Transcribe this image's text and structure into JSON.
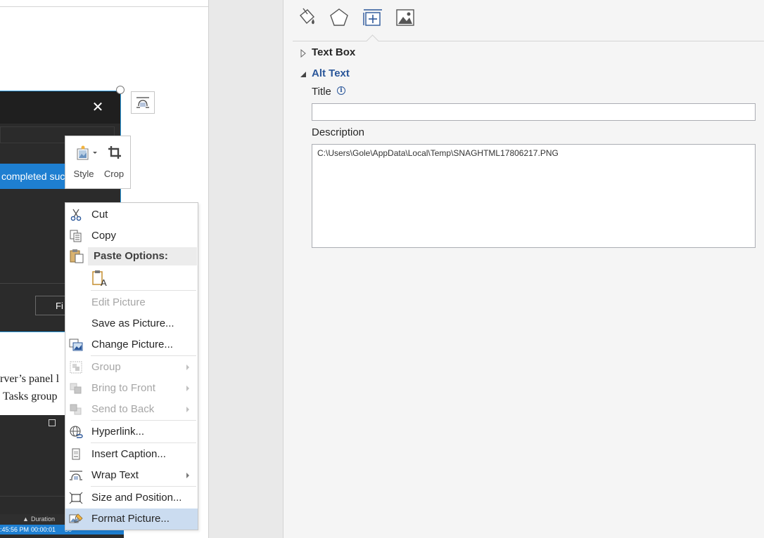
{
  "document": {
    "dialog_banner_text": "completed succ",
    "dialog_button_text": "Fi",
    "body_line_1": "rver’s panel l",
    "body_line_2": "Tasks group",
    "table_header": {
      "duration": "Duration"
    },
    "table_row": {
      "time": ":45:56 PM",
      "duration": "00:00:01",
      "extra": "50"
    }
  },
  "mini_toolbar": {
    "style_label": "Style",
    "crop_label": "Crop"
  },
  "context_menu": {
    "cut": "Cut",
    "copy": "Copy",
    "paste_options": "Paste Options:",
    "edit_picture": "Edit Picture",
    "save_as_picture": "Save as Picture...",
    "change_picture": "Change Picture...",
    "group": "Group",
    "bring_to_front": "Bring to Front",
    "send_to_back": "Send to Back",
    "hyperlink": "Hyperlink...",
    "insert_caption": "Insert Caption...",
    "wrap_text": "Wrap Text",
    "size_and_position": "Size and Position...",
    "format_picture": "Format Picture..."
  },
  "format_panel": {
    "sections": {
      "text_box": "Text Box",
      "alt_text": "Alt Text"
    },
    "title_label": "Title",
    "title_value": "",
    "description_label": "Description",
    "description_value": "C:\\Users\\Gole\\AppData\\Local\\Temp\\SNAGHTML17806217.PNG"
  },
  "colors": {
    "accent": "#2b579a",
    "selection": "#1e7fd1",
    "menu_highlight": "#cbdcf0"
  }
}
